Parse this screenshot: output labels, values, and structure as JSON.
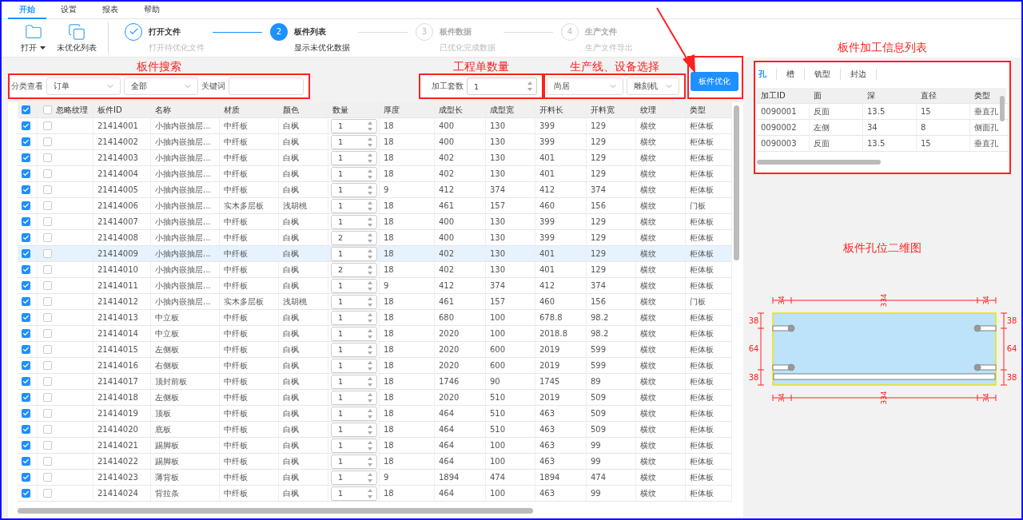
{
  "menu": [
    {
      "label": "开始",
      "selected": true
    },
    {
      "label": "设置",
      "selected": false
    },
    {
      "label": "报表",
      "selected": false
    },
    {
      "label": "帮助",
      "selected": false
    }
  ],
  "toolbar": {
    "buttons": [
      {
        "kind": "open",
        "label": "打开"
      },
      {
        "kind": "list",
        "label": "未优化列表"
      }
    ]
  },
  "steps": [
    {
      "done": true,
      "selected": false,
      "title": "打开文件",
      "subtitle": "打开待优化文件"
    },
    {
      "done": false,
      "selected": true,
      "number": "2",
      "title": "板件列表",
      "subtitle": "显示未优化数据"
    },
    {
      "done": false,
      "selected": false,
      "number": "3",
      "title": "板件数据",
      "subtitle": "已优化完成数据"
    },
    {
      "done": false,
      "selected": false,
      "number": "4",
      "title": "生产文件",
      "subtitle": "生产文件导出"
    }
  ],
  "filter": {
    "annotation": "板件搜索",
    "category_label": "分类查看",
    "category": "订单",
    "scope": "全部",
    "keyword_label": "关键词"
  },
  "quantity": {
    "annotation": "工程单数量",
    "label": "加工套数",
    "value": "1"
  },
  "line_select": {
    "annotation": "生产线、设备选择",
    "line": "尚居",
    "machine": "雕刻机"
  },
  "optimize_button": "板件优化",
  "table": {
    "select_all": {
      "checked": true
    },
    "ignore_grain_all": {
      "checked": false,
      "label": "忽略纹理"
    },
    "columns": [
      {
        "label": "板件ID",
        "kind": "text"
      },
      {
        "label": "名称",
        "kind": "text"
      },
      {
        "label": "材质",
        "kind": "text"
      },
      {
        "label": "颜色",
        "kind": "text"
      },
      {
        "label": "数量",
        "kind": "spinner"
      },
      {
        "label": "厚度",
        "kind": "text"
      },
      {
        "label": "成型长",
        "kind": "text"
      },
      {
        "label": "成型宽",
        "kind": "text"
      },
      {
        "label": "开料长",
        "kind": "text"
      },
      {
        "label": "开料宽",
        "kind": "text"
      },
      {
        "label": "纹理",
        "kind": "text"
      },
      {
        "label": "类型",
        "kind": "text"
      }
    ],
    "rows": [
      {
        "checked": true,
        "ignore_grain": false,
        "selected": false,
        "cells": [
          "21414001",
          "小抽内嵌抽层...",
          "中纤板",
          "白枫",
          "1",
          "18",
          "400",
          "130",
          "399",
          "129",
          "横纹",
          "柜体板"
        ]
      },
      {
        "checked": true,
        "ignore_grain": false,
        "selected": false,
        "cells": [
          "21414002",
          "小抽内嵌抽层...",
          "中纤板",
          "白枫",
          "1",
          "18",
          "400",
          "130",
          "399",
          "129",
          "横纹",
          "柜体板"
        ]
      },
      {
        "checked": true,
        "ignore_grain": false,
        "selected": false,
        "cells": [
          "21414003",
          "小抽内嵌抽层...",
          "中纤板",
          "白枫",
          "1",
          "18",
          "402",
          "130",
          "401",
          "129",
          "横纹",
          "柜体板"
        ]
      },
      {
        "checked": true,
        "ignore_grain": false,
        "selected": false,
        "cells": [
          "21414004",
          "小抽内嵌抽层...",
          "中纤板",
          "白枫",
          "1",
          "18",
          "402",
          "130",
          "401",
          "129",
          "横纹",
          "柜体板"
        ]
      },
      {
        "checked": true,
        "ignore_grain": false,
        "selected": false,
        "cells": [
          "21414005",
          "小抽内嵌抽层...",
          "中纤板",
          "白枫",
          "1",
          "9",
          "412",
          "374",
          "412",
          "374",
          "横纹",
          "柜体板"
        ]
      },
      {
        "checked": true,
        "ignore_grain": false,
        "selected": false,
        "cells": [
          "21414006",
          "小抽内嵌抽层...",
          "实木多层板",
          "浅胡桃",
          "1",
          "18",
          "461",
          "157",
          "460",
          "156",
          "横纹",
          "门板"
        ]
      },
      {
        "checked": true,
        "ignore_grain": false,
        "selected": false,
        "cells": [
          "21414007",
          "小抽内嵌抽层...",
          "中纤板",
          "白枫",
          "1",
          "18",
          "400",
          "130",
          "399",
          "129",
          "横纹",
          "柜体板"
        ]
      },
      {
        "checked": true,
        "ignore_grain": false,
        "selected": false,
        "cells": [
          "21414008",
          "小抽内嵌抽层...",
          "中纤板",
          "白枫",
          "2",
          "18",
          "400",
          "130",
          "399",
          "129",
          "横纹",
          "柜体板"
        ]
      },
      {
        "checked": true,
        "ignore_grain": false,
        "selected": true,
        "cells": [
          "21414009",
          "小抽内嵌抽层...",
          "中纤板",
          "白枫",
          "1",
          "18",
          "402",
          "130",
          "401",
          "129",
          "横纹",
          "柜体板"
        ]
      },
      {
        "checked": true,
        "ignore_grain": false,
        "selected": false,
        "cells": [
          "21414010",
          "小抽内嵌抽层...",
          "中纤板",
          "白枫",
          "2",
          "18",
          "402",
          "130",
          "401",
          "129",
          "横纹",
          "柜体板"
        ]
      },
      {
        "checked": true,
        "ignore_grain": false,
        "selected": false,
        "cells": [
          "21414011",
          "小抽内嵌抽层...",
          "中纤板",
          "白枫",
          "1",
          "9",
          "412",
          "374",
          "412",
          "374",
          "横纹",
          "柜体板"
        ]
      },
      {
        "checked": true,
        "ignore_grain": false,
        "selected": false,
        "cells": [
          "21414012",
          "小抽内嵌抽层...",
          "实木多层板",
          "浅胡桃",
          "1",
          "18",
          "461",
          "157",
          "460",
          "156",
          "横纹",
          "门板"
        ]
      },
      {
        "checked": true,
        "ignore_grain": false,
        "selected": false,
        "cells": [
          "21414013",
          "中立板",
          "中纤板",
          "白枫",
          "1",
          "18",
          "680",
          "100",
          "678.8",
          "98.2",
          "横纹",
          "柜体板"
        ]
      },
      {
        "checked": true,
        "ignore_grain": false,
        "selected": false,
        "cells": [
          "21414014",
          "中立板",
          "中纤板",
          "白枫",
          "1",
          "18",
          "2020",
          "100",
          "2018.8",
          "98.2",
          "横纹",
          "柜体板"
        ]
      },
      {
        "checked": true,
        "ignore_grain": false,
        "selected": false,
        "cells": [
          "21414015",
          "左侧板",
          "中纤板",
          "白枫",
          "1",
          "18",
          "2020",
          "600",
          "2019",
          "599",
          "横纹",
          "柜体板"
        ]
      },
      {
        "checked": true,
        "ignore_grain": false,
        "selected": false,
        "cells": [
          "21414016",
          "右侧板",
          "中纤板",
          "白枫",
          "1",
          "18",
          "2020",
          "600",
          "2019",
          "599",
          "横纹",
          "柜体板"
        ]
      },
      {
        "checked": true,
        "ignore_grain": false,
        "selected": false,
        "cells": [
          "21414017",
          "顶封前板",
          "中纤板",
          "白枫",
          "1",
          "18",
          "1746",
          "90",
          "1745",
          "89",
          "横纹",
          "柜体板"
        ]
      },
      {
        "checked": true,
        "ignore_grain": false,
        "selected": false,
        "cells": [
          "21414018",
          "左侧板",
          "中纤板",
          "白枫",
          "1",
          "18",
          "2020",
          "510",
          "2019",
          "509",
          "横纹",
          "柜体板"
        ]
      },
      {
        "checked": true,
        "ignore_grain": false,
        "selected": false,
        "cells": [
          "21414019",
          "顶板",
          "中纤板",
          "白枫",
          "1",
          "18",
          "464",
          "510",
          "463",
          "509",
          "横纹",
          "柜体板"
        ]
      },
      {
        "checked": true,
        "ignore_grain": false,
        "selected": false,
        "cells": [
          "21414020",
          "底板",
          "中纤板",
          "白枫",
          "1",
          "18",
          "464",
          "510",
          "463",
          "509",
          "横纹",
          "柜体板"
        ]
      },
      {
        "checked": true,
        "ignore_grain": false,
        "selected": false,
        "cells": [
          "21414021",
          "踢脚板",
          "中纤板",
          "白枫",
          "1",
          "18",
          "464",
          "100",
          "463",
          "99",
          "横纹",
          "柜体板"
        ]
      },
      {
        "checked": true,
        "ignore_grain": false,
        "selected": false,
        "cells": [
          "21414022",
          "踢脚板",
          "中纤板",
          "白枫",
          "1",
          "18",
          "464",
          "100",
          "463",
          "99",
          "横纹",
          "柜体板"
        ]
      },
      {
        "checked": true,
        "ignore_grain": false,
        "selected": false,
        "cells": [
          "21414023",
          "薄背板",
          "中纤板",
          "白枫",
          "1",
          "9",
          "1894",
          "474",
          "1894",
          "474",
          "横纹",
          "柜体板"
        ]
      },
      {
        "checked": true,
        "ignore_grain": false,
        "selected": false,
        "cells": [
          "21414024",
          "背拉条",
          "中纤板",
          "白枫",
          "1",
          "18",
          "464",
          "100",
          "463",
          "99",
          "横纹",
          "柜体板"
        ]
      }
    ]
  },
  "info_panel": {
    "annotation": "板件加工信息列表",
    "tabs": [
      {
        "label": "孔",
        "selected": true
      },
      {
        "label": "槽",
        "selected": false
      },
      {
        "label": "铣型",
        "selected": false
      },
      {
        "label": "封边",
        "selected": false
      }
    ],
    "columns": [
      "加工ID",
      "面",
      "深",
      "直径",
      "类型"
    ],
    "rows": [
      [
        "0090001",
        "反面",
        "13.5",
        "15",
        "垂直孔"
      ],
      [
        "0090002",
        "左侧",
        "34",
        "8",
        "侧面孔"
      ],
      [
        "0090003",
        "反面",
        "13.5",
        "15",
        "垂直孔"
      ]
    ]
  },
  "drawing": {
    "annotation": "板件孔位二维图",
    "top_dims": [
      "34",
      "334",
      "34"
    ],
    "bottom_dims": [
      "34",
      "334",
      "34"
    ],
    "left_dims": [
      "38",
      "64",
      "38"
    ],
    "right_dims": [
      "38",
      "64",
      "38"
    ]
  }
}
